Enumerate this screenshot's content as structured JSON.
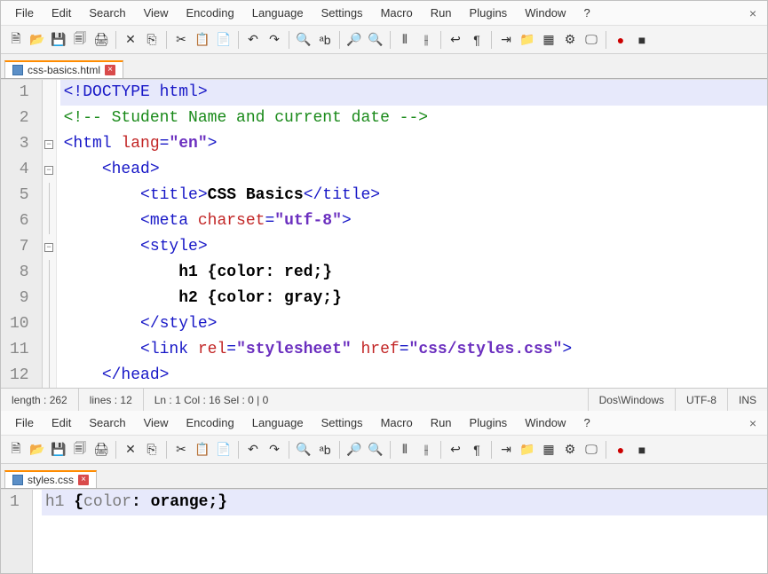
{
  "menus": [
    "File",
    "Edit",
    "Search",
    "View",
    "Encoding",
    "Language",
    "Settings",
    "Macro",
    "Run",
    "Plugins",
    "Window",
    "?"
  ],
  "toolbar_icons": [
    {
      "name": "new-file-icon",
      "glyph": "🗎"
    },
    {
      "name": "open-file-icon",
      "glyph": "📂"
    },
    {
      "name": "save-icon",
      "glyph": "💾"
    },
    {
      "name": "save-all-icon",
      "glyph": "🗐"
    },
    {
      "name": "print-icon",
      "glyph": "🖨"
    },
    {
      "sep": true
    },
    {
      "name": "close-file-icon",
      "glyph": "✕"
    },
    {
      "name": "close-all-icon",
      "glyph": "⎘"
    },
    {
      "sep": true
    },
    {
      "name": "cut-icon",
      "glyph": "✂"
    },
    {
      "name": "copy-icon",
      "glyph": "📋"
    },
    {
      "name": "paste-icon",
      "glyph": "📄"
    },
    {
      "sep": true
    },
    {
      "name": "undo-icon",
      "glyph": "↶"
    },
    {
      "name": "redo-icon",
      "glyph": "↷"
    },
    {
      "sep": true
    },
    {
      "name": "find-icon",
      "glyph": "🔍"
    },
    {
      "name": "replace-icon",
      "glyph": "ᵃb"
    },
    {
      "sep": true
    },
    {
      "name": "zoom-in-icon",
      "glyph": "🔎"
    },
    {
      "name": "zoom-out-icon",
      "glyph": "🔍"
    },
    {
      "sep": true
    },
    {
      "name": "sync-v-icon",
      "glyph": "⫴"
    },
    {
      "name": "sync-h-icon",
      "glyph": "⫲"
    },
    {
      "sep": true
    },
    {
      "name": "wordwrap-icon",
      "glyph": "↩"
    },
    {
      "name": "pilcrow-icon",
      "glyph": "¶"
    },
    {
      "sep": true
    },
    {
      "name": "indent-icon",
      "glyph": "⇥"
    },
    {
      "name": "folder-icon",
      "glyph": "📁"
    },
    {
      "name": "doc-map-icon",
      "glyph": "▦"
    },
    {
      "name": "function-list-icon",
      "glyph": "⚙"
    },
    {
      "name": "monitor-icon",
      "glyph": "🖵"
    },
    {
      "sep": true
    },
    {
      "name": "record-icon",
      "glyph": "●"
    },
    {
      "name": "stop-icon",
      "glyph": "■"
    }
  ],
  "pane1": {
    "tab": {
      "filename": "css-basics.html"
    },
    "lines": [
      {
        "n": 1,
        "hl": true,
        "fold": "",
        "tokens": [
          {
            "c": "c-tag",
            "t": "<!DOCTYPE html>"
          }
        ]
      },
      {
        "n": 2,
        "fold": "",
        "tokens": [
          {
            "c": "c-comment",
            "t": "<!-- Student Name and current date -->"
          }
        ]
      },
      {
        "n": 3,
        "fold": "box",
        "tokens": [
          {
            "c": "c-tag",
            "t": "<html "
          },
          {
            "c": "c-attr",
            "t": "lang"
          },
          {
            "c": "c-tag",
            "t": "="
          },
          {
            "c": "c-str",
            "t": "\"en\""
          },
          {
            "c": "c-tag",
            "t": ">"
          }
        ]
      },
      {
        "n": 4,
        "fold": "box",
        "indent": "    ",
        "tokens": [
          {
            "c": "c-tag",
            "t": "<head>"
          }
        ]
      },
      {
        "n": 5,
        "fold": "line",
        "indent": "        ",
        "tokens": [
          {
            "c": "c-tag",
            "t": "<title>"
          },
          {
            "c": "c-bold",
            "t": "CSS Basics"
          },
          {
            "c": "c-tag",
            "t": "</title>"
          }
        ]
      },
      {
        "n": 6,
        "fold": "line",
        "indent": "        ",
        "tokens": [
          {
            "c": "c-tag",
            "t": "<meta "
          },
          {
            "c": "c-attr",
            "t": "charset"
          },
          {
            "c": "c-tag",
            "t": "="
          },
          {
            "c": "c-str",
            "t": "\"utf-8\""
          },
          {
            "c": "c-tag",
            "t": ">"
          }
        ]
      },
      {
        "n": 7,
        "fold": "box",
        "indent": "        ",
        "tokens": [
          {
            "c": "c-tag",
            "t": "<style>"
          }
        ]
      },
      {
        "n": 8,
        "fold": "line",
        "indent": "            ",
        "tokens": [
          {
            "c": "c-bold",
            "t": "h1 {color: red;}"
          }
        ]
      },
      {
        "n": 9,
        "fold": "line",
        "indent": "            ",
        "tokens": [
          {
            "c": "c-bold",
            "t": "h2 {color: gray;}"
          }
        ]
      },
      {
        "n": 10,
        "fold": "line",
        "indent": "        ",
        "tokens": [
          {
            "c": "c-tag",
            "t": "</style>"
          }
        ]
      },
      {
        "n": 11,
        "fold": "line",
        "indent": "        ",
        "tokens": [
          {
            "c": "c-tag",
            "t": "<link "
          },
          {
            "c": "c-attr",
            "t": "rel"
          },
          {
            "c": "c-tag",
            "t": "="
          },
          {
            "c": "c-str",
            "t": "\"stylesheet\""
          },
          {
            "c": "c-tag",
            "t": " "
          },
          {
            "c": "c-attr",
            "t": "href"
          },
          {
            "c": "c-tag",
            "t": "="
          },
          {
            "c": "c-str",
            "t": "\"css/styles.css\""
          },
          {
            "c": "c-tag",
            "t": ">"
          }
        ]
      },
      {
        "n": 12,
        "fold": "line",
        "indent": "    ",
        "tokens": [
          {
            "c": "c-tag",
            "t": "</head>"
          }
        ]
      }
    ],
    "status": {
      "length": "length : 262",
      "lines": "lines : 12",
      "pos": "Ln : 1   Col : 16   Sel : 0 | 0",
      "eol": "Dos\\Windows",
      "enc": "UTF-8",
      "mode": "INS"
    }
  },
  "pane2": {
    "tab": {
      "filename": "styles.css"
    },
    "lines": [
      {
        "n": 1,
        "hl": true,
        "tokens": [
          {
            "c": "c-sel",
            "t": "h1 "
          },
          {
            "c": "c-brace",
            "t": "{"
          },
          {
            "c": "c-sel",
            "t": "color"
          },
          {
            "c": "c-prop",
            "t": ": orange;"
          },
          {
            "c": "c-brace",
            "t": "}"
          }
        ]
      }
    ]
  }
}
